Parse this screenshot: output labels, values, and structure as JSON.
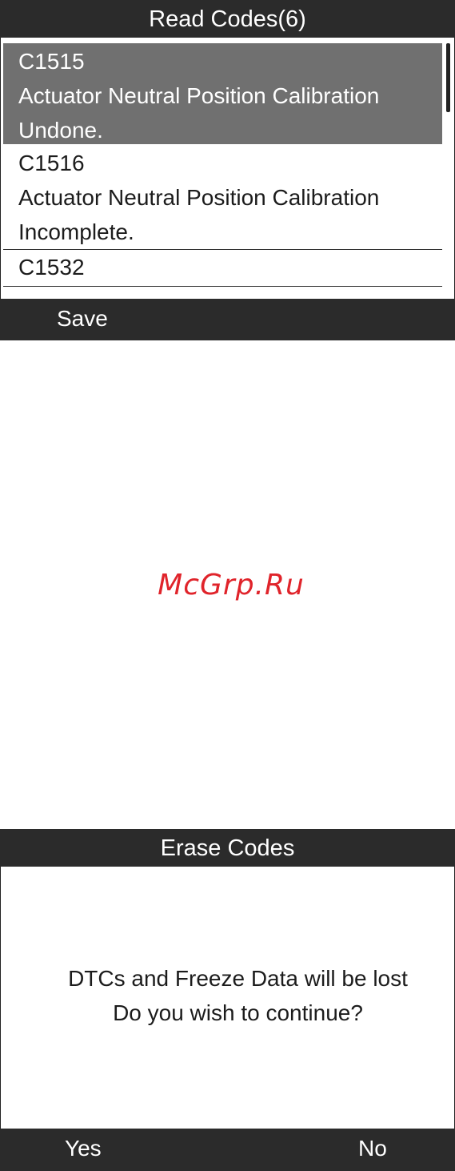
{
  "read_codes": {
    "title": "Read Codes(6)",
    "items": [
      {
        "code": "C1515",
        "line1": "Actuator Neutral Position Calibration",
        "line2": "Undone.",
        "selected": true
      },
      {
        "code": "C1516",
        "line1": "Actuator Neutral Position Calibration",
        "line2": "Incomplete.",
        "selected": false
      },
      {
        "code": "C1532",
        "selected": false
      }
    ],
    "softkeys": {
      "left": "Save"
    }
  },
  "watermark": "McGrp.Ru",
  "erase_codes": {
    "title": "Erase Codes",
    "message_line1": "DTCs and Freeze Data will be lost",
    "message_line2": "Do you wish to continue?",
    "softkeys": {
      "left": "Yes",
      "right": "No"
    }
  },
  "colors": {
    "bar_background": "#2b2b2b",
    "selected_row": "#707070",
    "watermark": "#e0242b"
  }
}
